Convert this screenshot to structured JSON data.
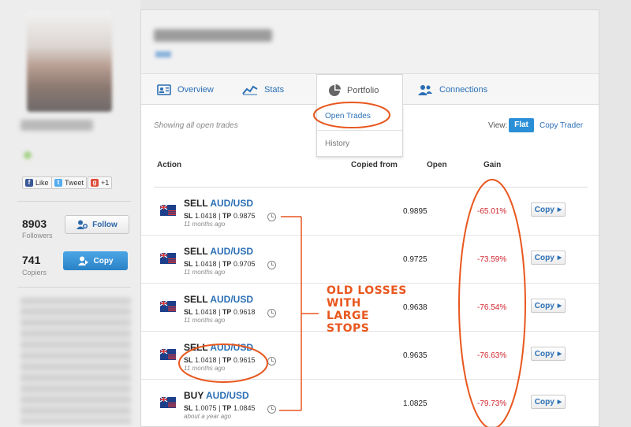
{
  "sidebar": {
    "social": [
      {
        "label": "Like",
        "icon": "facebook-icon"
      },
      {
        "label": "Tweet",
        "icon": "twitter-icon"
      },
      {
        "label": "+1",
        "icon": "google-plus-icon"
      }
    ],
    "followers_count": "8903",
    "followers_label": "Followers",
    "follow_button": "Follow",
    "copiers_count": "741",
    "copiers_label": "Copiers",
    "copy_button": "Copy"
  },
  "tabs": [
    {
      "label": "Overview",
      "icon": "overview-icon"
    },
    {
      "label": "Stats",
      "icon": "stats-chart-icon"
    },
    {
      "label": "Portfolio",
      "icon": "pie-chart-icon",
      "active": true
    },
    {
      "label": "Connections",
      "icon": "people-icon"
    }
  ],
  "dropdown": {
    "items": [
      "Open Trades",
      "History"
    ]
  },
  "toolbar": {
    "showing": "Showing all open trades",
    "view_label": "View:",
    "view_flat": "Flat",
    "view_copy_trader": "Copy Trader"
  },
  "columns": {
    "action": "Action",
    "copied_from": "Copied from",
    "open": "Open",
    "gain": "Gain"
  },
  "trades": [
    {
      "side": "SELL",
      "pair": "AUD/USD",
      "sl": "1.0418",
      "tp": "0.9875",
      "ago": "11 months ago",
      "open": "0.9895",
      "gain": "-65.01%",
      "copy": "Copy"
    },
    {
      "side": "SELL",
      "pair": "AUD/USD",
      "sl": "1.0418",
      "tp": "0.9705",
      "ago": "11 months ago",
      "open": "0.9725",
      "gain": "-73.59%",
      "copy": "Copy"
    },
    {
      "side": "SELL",
      "pair": "AUD/USD",
      "sl": "1.0418",
      "tp": "0.9618",
      "ago": "11 months ago",
      "open": "0.9638",
      "gain": "-76.54%",
      "copy": "Copy"
    },
    {
      "side": "SELL",
      "pair": "AUD/USD",
      "sl": "1.0418",
      "tp": "0.9615",
      "ago": "11 months ago",
      "open": "0.9635",
      "gain": "-76.63%",
      "copy": "Copy"
    },
    {
      "side": "BUY",
      "pair": "AUD/USD",
      "sl": "1.0075",
      "tp": "1.0845",
      "ago": "about a year ago",
      "open": "1.0825",
      "gain": "-79.73%",
      "copy": "Copy"
    }
  ],
  "labels": {
    "sl": "SL",
    "tp": "TP"
  },
  "annotation": {
    "lines": [
      "OLD LOSSES",
      "WITH",
      "LARGE",
      "STOPS"
    ],
    "color": "#e8571e"
  },
  "colors": {
    "accent": "#2a6fb5",
    "loss": "#d0242d",
    "flat_button": "#2a8fd6"
  }
}
